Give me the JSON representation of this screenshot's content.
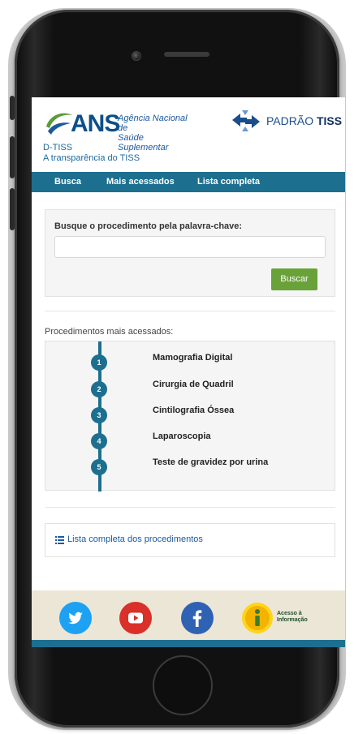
{
  "header": {
    "ans_logo_text": "ANS",
    "agency_line1": "Agência Nacional de",
    "agency_line2": "Saúde Suplementar",
    "tiss_label_light": "PADRÃO",
    "tiss_label_bold": "TISS",
    "dtiss_title": "D-TISS",
    "dtiss_subtitle": "A transparência do TISS"
  },
  "nav": {
    "items": [
      {
        "label": "Busca"
      },
      {
        "label": "Mais acessados"
      },
      {
        "label": "Lista completa"
      }
    ]
  },
  "search": {
    "label": "Busque o procedimento pela palavra-chave:",
    "value": "",
    "placeholder": "",
    "button_label": "Buscar"
  },
  "popular": {
    "title": "Procedimentos mais acessados:",
    "items": [
      {
        "number": "1",
        "label": "Mamografia Digital"
      },
      {
        "number": "2",
        "label": "Cirurgia de Quadril"
      },
      {
        "number": "3",
        "label": "Cintilografia Óssea"
      },
      {
        "number": "4",
        "label": "Laparoscopia"
      },
      {
        "number": "5",
        "label": "Teste de gravidez por urina"
      }
    ]
  },
  "full_list": {
    "label": "Lista completa dos procedimentos",
    "icon": "list-icon"
  },
  "footer": {
    "social": [
      {
        "name": "twitter",
        "icon": "twitter-icon",
        "color": "#1da1f2"
      },
      {
        "name": "youtube",
        "icon": "youtube-icon",
        "color": "#d9302a"
      },
      {
        "name": "facebook",
        "icon": "facebook-icon",
        "color": "#2f62b3"
      },
      {
        "name": "acesso-informacao",
        "icon": "info-icon",
        "color": "#ffd41a"
      }
    ],
    "acesso_line1": "Acesso à",
    "acesso_line2": "Informação"
  },
  "colors": {
    "nav": "#1d6f8f",
    "button": "#6aa23a",
    "footer": "#ece6d6"
  }
}
